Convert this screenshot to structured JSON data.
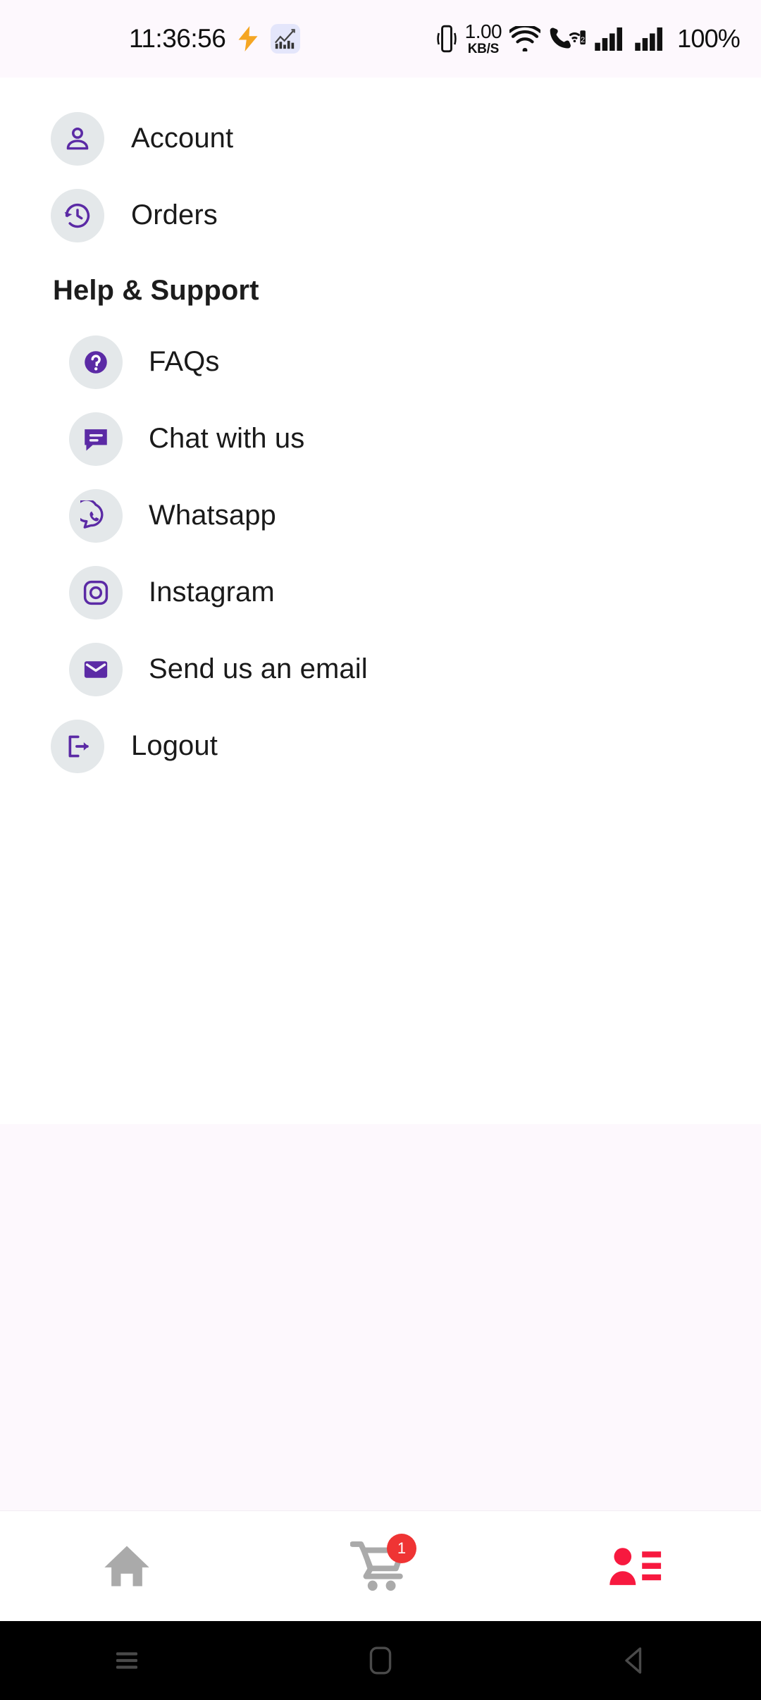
{
  "status_bar": {
    "time": "11:36:56",
    "network_speed_value": "1.00",
    "network_speed_unit": "KB/S",
    "battery": "100%",
    "sim_badge": "2",
    "icons": [
      "lightning-bolt-icon",
      "chart-app-icon",
      "vibrate-icon",
      "wifi-icon",
      "vowifi-call-icon",
      "signal-bars-icon",
      "signal-bars-icon"
    ]
  },
  "menu": {
    "primary": [
      {
        "label": "Account",
        "icon": "person-icon"
      },
      {
        "label": "Orders",
        "icon": "order-history-clock-icon"
      }
    ],
    "section_title": "Help & Support",
    "support": [
      {
        "label": "FAQs",
        "icon": "question-mark-circle-icon"
      },
      {
        "label": "Chat with us",
        "icon": "chat-bubble-icon"
      },
      {
        "label": "Whatsapp",
        "icon": "whatsapp-icon"
      },
      {
        "label": "Instagram",
        "icon": "instagram-icon"
      },
      {
        "label": "Send us an email",
        "icon": "envelope-icon"
      }
    ],
    "logout": {
      "label": "Logout",
      "icon": "logout-icon"
    }
  },
  "bottom_nav": {
    "items": [
      {
        "name": "home",
        "icon": "home-icon",
        "active": false
      },
      {
        "name": "cart",
        "icon": "shopping-cart-icon",
        "active": false,
        "badge": "1"
      },
      {
        "name": "profile",
        "icon": "profile-list-icon",
        "active": true
      }
    ]
  },
  "android_nav": {
    "recents": "recents-icon",
    "home": "home-square-icon",
    "back": "back-triangle-icon"
  },
  "colors": {
    "accent_purple": "#5b2aa5",
    "icon_bg": "#e4e8ea",
    "badge_red": "#ef3434",
    "active_nav": "#f7193f",
    "inactive_nav": "#aaaaaa",
    "page_tint": "#fdf8fd"
  }
}
